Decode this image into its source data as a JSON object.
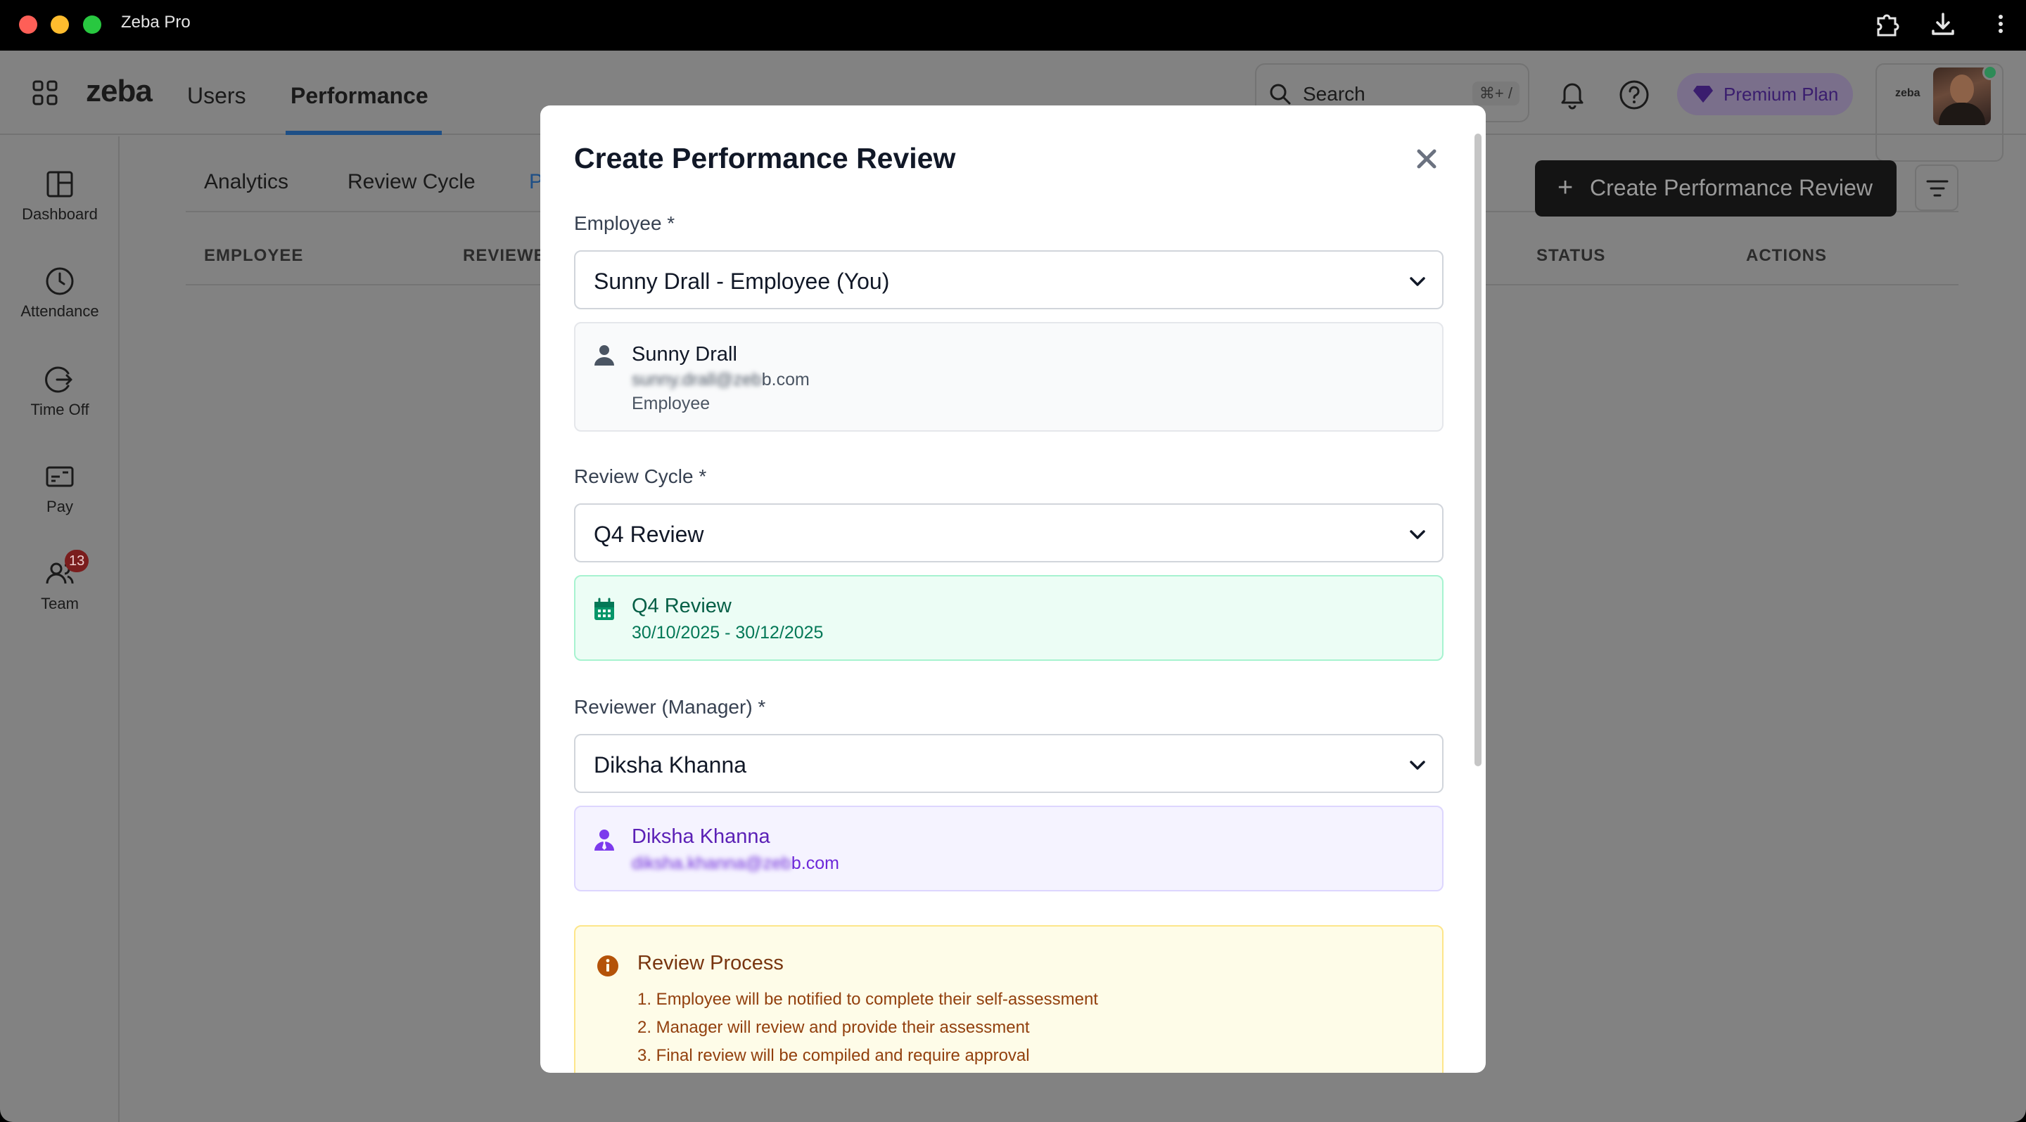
{
  "window": {
    "app_title": "Zeba Pro"
  },
  "topnav": {
    "logo": "zeba",
    "tabs": [
      {
        "label": "Users"
      },
      {
        "label": "Performance"
      }
    ],
    "search": {
      "label": "Search",
      "shortcut": "⌘+ /"
    },
    "premium_label": "Premium Plan",
    "mini_logo": "zeba"
  },
  "sidebar": {
    "items": [
      {
        "label": "Dashboard",
        "icon": "dashboard-icon"
      },
      {
        "label": "Attendance",
        "icon": "clock-icon"
      },
      {
        "label": "Time Off",
        "icon": "time-off-icon"
      },
      {
        "label": "Pay",
        "icon": "card-icon"
      },
      {
        "label": "Team",
        "icon": "team-icon",
        "badge": "13"
      }
    ]
  },
  "page": {
    "subtabs": [
      "Analytics",
      "Review Cycle",
      "P"
    ],
    "create_button_label": "Create Performance Review",
    "columns": [
      "EMPLOYEE",
      "REVIEWE",
      "STATUS",
      "ACTIONS"
    ]
  },
  "modal": {
    "title": "Create Performance Review",
    "employee": {
      "label": "Employee *",
      "selected": "Sunny Drall - Employee (You)",
      "card": {
        "name": "Sunny Drall",
        "email_suffix": "b.com",
        "email_masked": "sunny.drall@zeb",
        "role": "Employee"
      }
    },
    "review_cycle": {
      "label": "Review Cycle *",
      "selected": "Q4 Review",
      "card": {
        "name": "Q4 Review",
        "dates": "30/10/2025 - 30/12/2025"
      }
    },
    "reviewer": {
      "label": "Reviewer (Manager) *",
      "selected": "Diksha Khanna",
      "card": {
        "name": "Diksha Khanna",
        "email_masked": "diksha.khanna@zeb",
        "email_suffix": "b.com"
      }
    },
    "process": {
      "title": "Review Process",
      "steps": [
        "1. Employee will be notified to complete their self-assessment",
        "2. Manager will review and provide their assessment",
        "3. Final review will be compiled and require approval"
      ]
    }
  },
  "colors": {
    "accent": "#1e4f86",
    "green_text": "#065f46",
    "purple_text": "#5b21b6",
    "yellow_text": "#78350f",
    "badge": "#dc2626"
  }
}
